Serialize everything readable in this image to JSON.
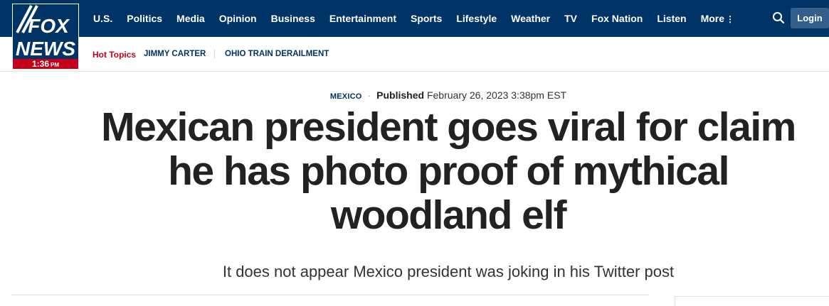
{
  "logo": {
    "line1": "FOX",
    "line2": "NEWS",
    "time": "1:36",
    "ampm": "PM"
  },
  "nav": {
    "items": [
      "U.S.",
      "Politics",
      "Media",
      "Opinion",
      "Business",
      "Entertainment",
      "Sports",
      "Lifestyle",
      "Weather",
      "TV",
      "Fox Nation",
      "Listen",
      "More"
    ],
    "more_icon": "⋮",
    "search_icon": "search-icon",
    "login_label": "Login"
  },
  "hot_topics": {
    "label": "Hot Topics",
    "items": [
      "JIMMY CARTER",
      "OHIO TRAIN DERAILMENT"
    ]
  },
  "article": {
    "category": "MEXICO",
    "published_label": "Published",
    "published_date": "February 26, 2023 3:38pm EST",
    "headline": "Mexican president goes viral for claim he has photo proof of mythical woodland elf",
    "subheadline": "It does not appear Mexico president was joking in his Twitter post"
  },
  "colors": {
    "navy": "#003366",
    "red": "#c6001a",
    "text": "#222222"
  }
}
